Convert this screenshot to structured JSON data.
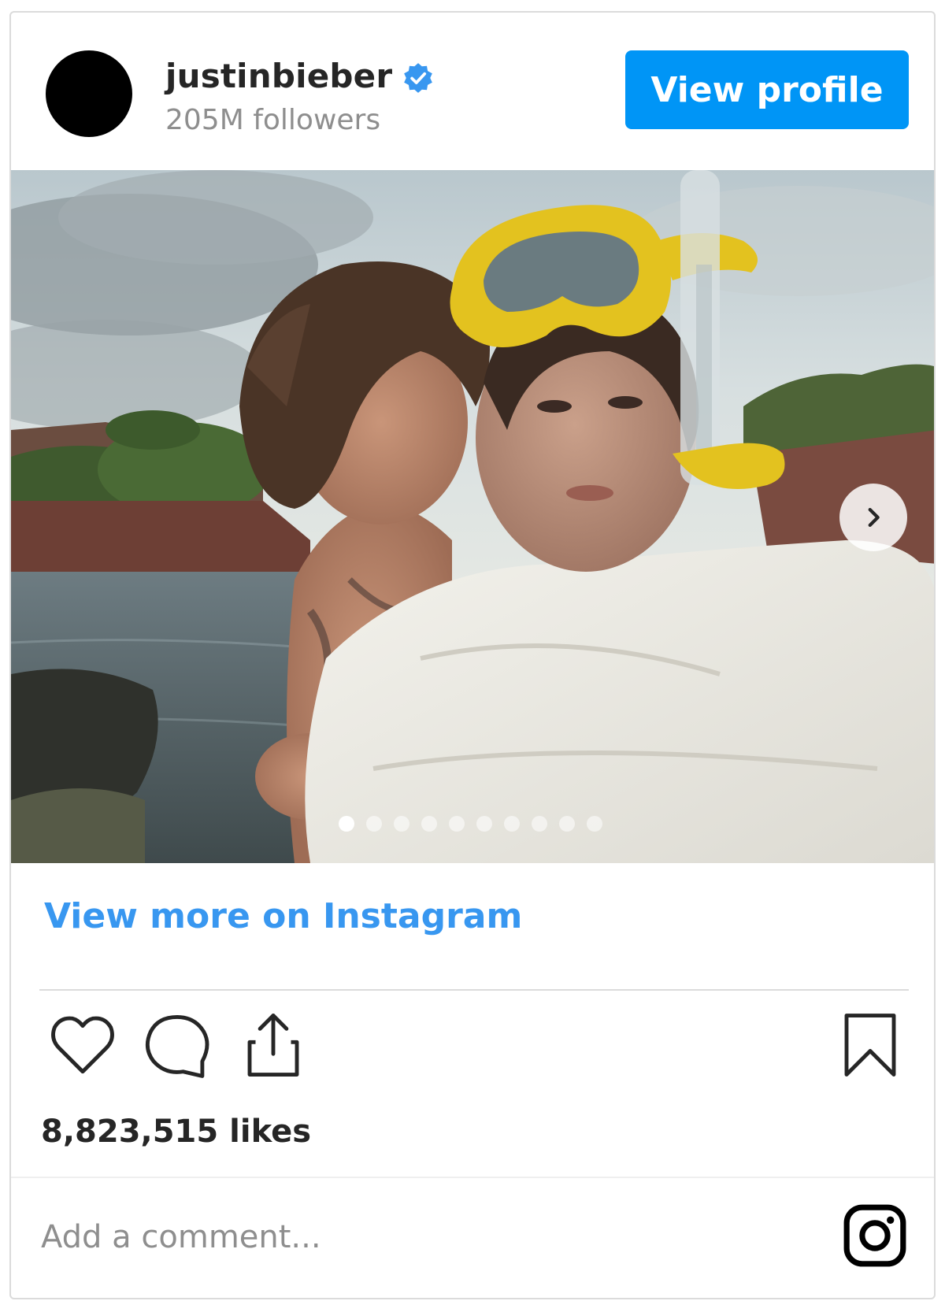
{
  "header": {
    "username": "justinbieber",
    "followers": "205M followers",
    "view_profile_label": "View profile",
    "verified_icon": "verified-badge-icon"
  },
  "media": {
    "carousel_total": 10,
    "carousel_active_index": 0,
    "next_icon": "chevron-right-icon"
  },
  "links": {
    "view_more": "View more on Instagram"
  },
  "actions": {
    "icons": [
      "heart-icon",
      "comment-icon",
      "share-icon",
      "bookmark-icon"
    ]
  },
  "stats": {
    "likes": "8,823,515 likes"
  },
  "comment": {
    "placeholder": "Add a comment..."
  },
  "colors": {
    "accent": "#0095f6",
    "link": "#3897f0",
    "verified": "#3897f0",
    "text": "#262626",
    "muted": "#8e8e8e"
  }
}
